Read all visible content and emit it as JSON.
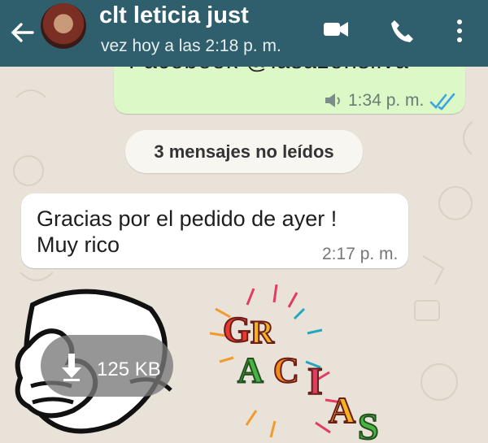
{
  "header": {
    "contact_name": "clt leticia just",
    "last_seen": "vez hoy a las 2:18 p. m."
  },
  "messages": {
    "outgoing": {
      "cut_text": "Facebook @lasazonsilva",
      "time": "1:34 p. m."
    },
    "unread_banner": "3 mensajes no leídos",
    "incoming": {
      "lines": [
        "Gracias por el pedido de ayer !",
        "Muy rico"
      ],
      "time": "2:17 p. m."
    },
    "sticker_download": {
      "size": "125 KB"
    },
    "gracias_sticker": {
      "letters": [
        "G",
        "R",
        "A",
        "C",
        "I",
        "A",
        "S"
      ]
    }
  },
  "colors": {
    "header": "#2f5f6d",
    "outgoing_bubble": "#dcf8c6",
    "read_ticks": "#3aa6df"
  },
  "icons": [
    "back-arrow-icon",
    "video-call-icon",
    "phone-icon",
    "more-options-icon",
    "speaker-icon",
    "double-check-icon",
    "download-icon"
  ]
}
